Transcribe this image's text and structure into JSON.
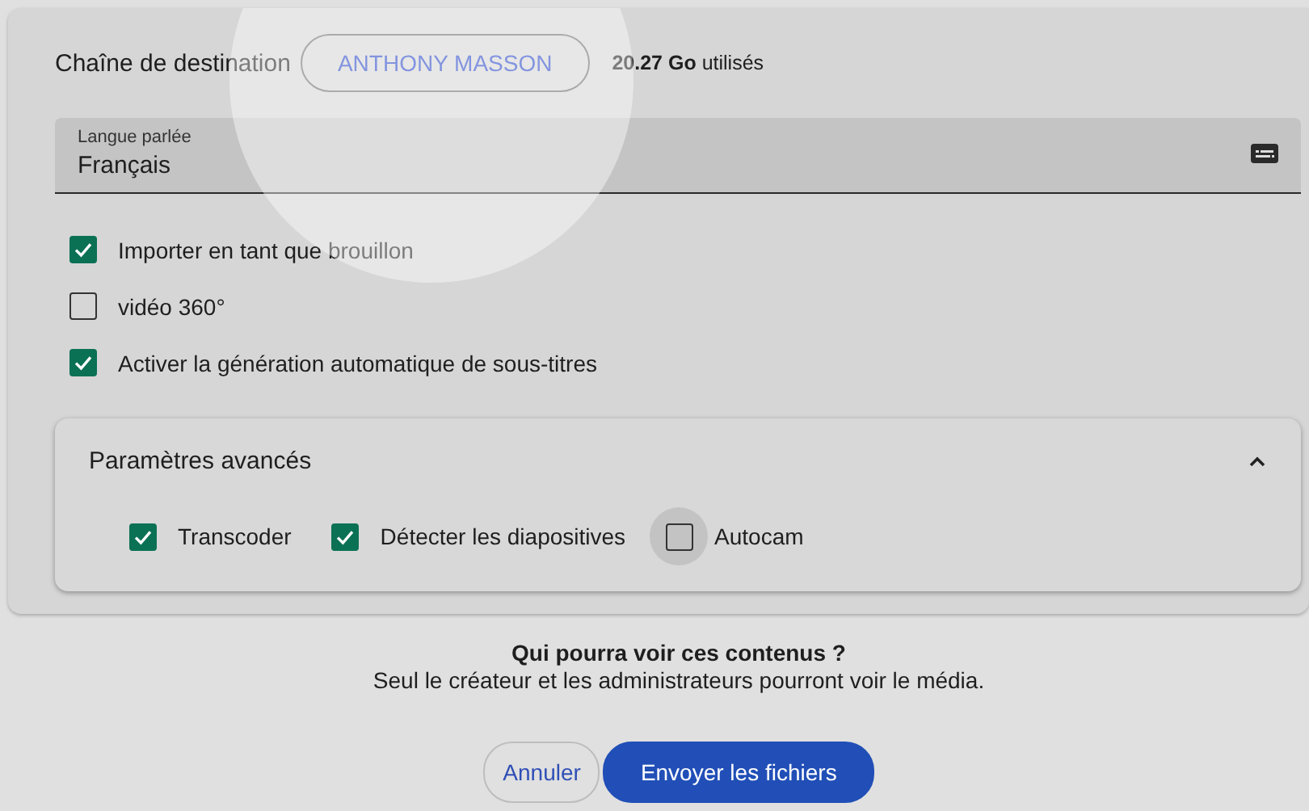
{
  "destination": {
    "label": "Chaîne de destination",
    "channel": "ANTHONY MASSON",
    "storage": "**20.27 Go** utilisés",
    "spotlight": true
  },
  "language": {
    "label": "Langue parlée",
    "value": "Français"
  },
  "options": [
    {
      "label": "Importer en tant que brouillon",
      "checked": true
    },
    {
      "label": "vidéo 360°",
      "checked": false
    },
    {
      "label": "Activer la génération automatique de sous-titres",
      "checked": true
    }
  ],
  "advanced": {
    "title": "Paramètres avancés",
    "expanded": true,
    "options": [
      {
        "label": "Transcoder",
        "checked": true,
        "focused": false
      },
      {
        "label": "Détecter les diapositives",
        "checked": true,
        "focused": false
      },
      {
        "label": "Autocam",
        "checked": false,
        "focused": true
      }
    ]
  },
  "visibility": {
    "title": "Qui pourra voir ces contenus ?",
    "text": "Seul le créateur et les administrateurs pourront voir le média."
  },
  "buttons": [
    {
      "label": "Annuler",
      "kind": "secondary"
    },
    {
      "label": "Envoyer les fichiers",
      "kind": "primary"
    }
  ]
}
